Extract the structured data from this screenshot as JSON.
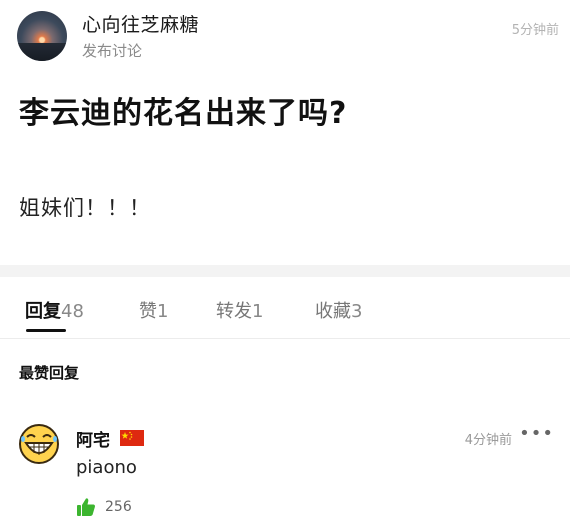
{
  "post": {
    "author": "心向往芝麻糖",
    "type": "发布讨论",
    "time": "5分钟前",
    "title": "李云迪的花名出来了吗?",
    "body": "姐妹们！！！"
  },
  "tabs": [
    {
      "label": "回复",
      "count": "48"
    },
    {
      "label": "赞",
      "count": "1"
    },
    {
      "label": "转发",
      "count": "1"
    },
    {
      "label": "收藏",
      "count": "3"
    }
  ],
  "section_label": "最赞回复",
  "comment": {
    "author": "阿宅",
    "time": "4分钟前",
    "more": "•••",
    "text": "piaono",
    "likes": "256"
  },
  "colors": {
    "like_green": "#3cb52f",
    "flag_red": "#de2910",
    "flag_star": "#ffde00",
    "emoji_yellow": "#ffd34e"
  }
}
